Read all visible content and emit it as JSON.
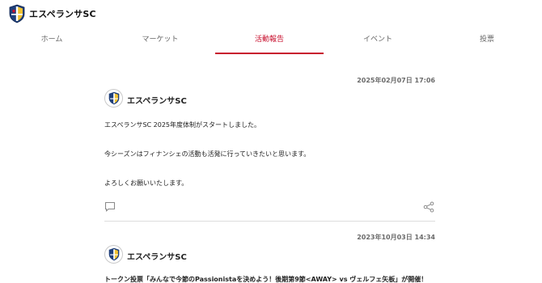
{
  "header": {
    "brand": "エスペランサSC",
    "logo_icon": "club-crest-icon"
  },
  "tabs": [
    {
      "label": "ホーム",
      "active": false
    },
    {
      "label": "マーケット",
      "active": false
    },
    {
      "label": "活動報告",
      "active": true
    },
    {
      "label": "イベント",
      "active": false
    },
    {
      "label": "投票",
      "active": false
    }
  ],
  "accent_color": "#c8102e",
  "posts": [
    {
      "date": "2025年02月07日 17:06",
      "author": "エスペランサSC",
      "lines": [
        "エスペランサSC 2025年度体制がスタートしました。",
        "今シーズンはフィナンシェの活動も活発に行っていきたいと思います。",
        "よろしくお願いいたします。"
      ],
      "comment_icon": "comment-icon",
      "share_icon": "share-icon"
    },
    {
      "date": "2023年10月03日 14:34",
      "author": "エスペランサSC",
      "lines": [
        "トークン投票「みんなで今節のPassionistaを決めよう！後期第9節<AWAY> vs ヴェルフェ矢板」が開催！"
      ]
    }
  ]
}
